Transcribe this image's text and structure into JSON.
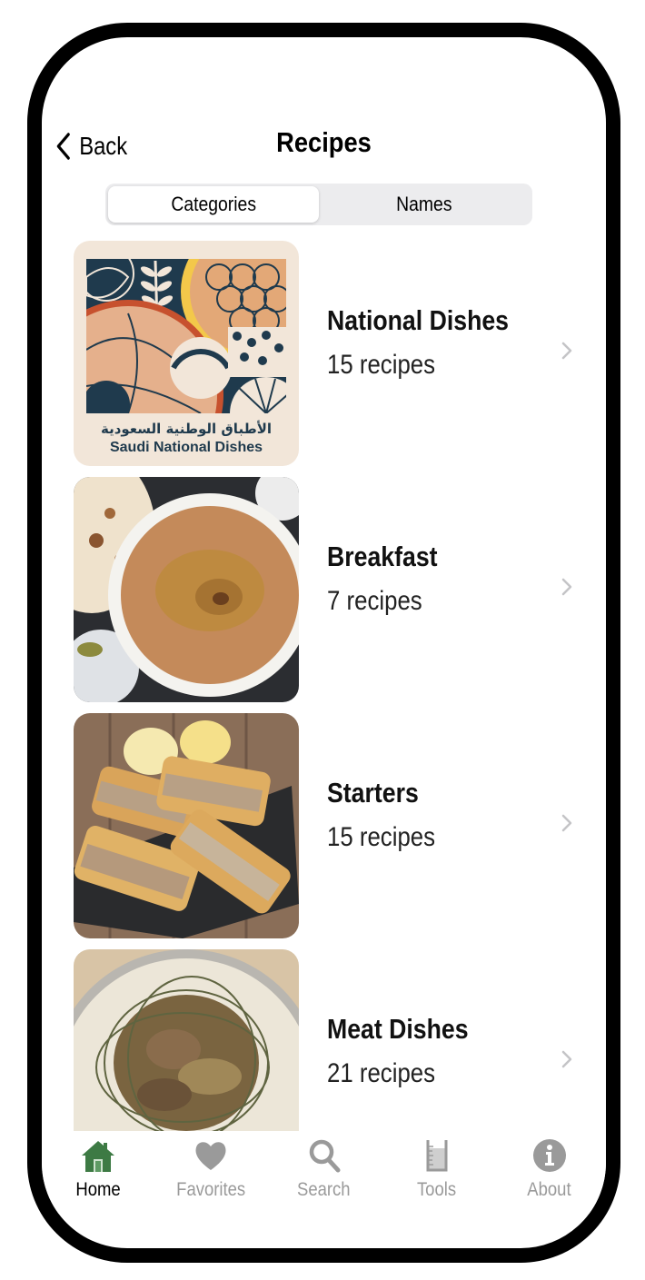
{
  "header": {
    "back_label": "Back",
    "title": "Recipes"
  },
  "segmented": {
    "options": [
      "Categories",
      "Names"
    ],
    "selected": "Categories"
  },
  "categories": [
    {
      "name": "National Dishes",
      "count": "15 recipes",
      "image": "Saudi National Dishes logo",
      "logo_text_ar": "الأطباق الوطنية السعودية",
      "logo_text_en": "Saudi National Dishes"
    },
    {
      "name": "Breakfast",
      "count": "7 recipes",
      "image": "bowl of ful medames with bread"
    },
    {
      "name": "Starters",
      "count": "15 recipes",
      "image": "mutabbaq pastries with lemon"
    },
    {
      "name": "Meat Dishes",
      "count": "21 recipes",
      "image": "meat on rice platter"
    }
  ],
  "tabbar": {
    "items": [
      {
        "label": "Home",
        "icon": "house-icon",
        "active": true
      },
      {
        "label": "Favorites",
        "icon": "heart-icon",
        "active": false
      },
      {
        "label": "Search",
        "icon": "search-icon",
        "active": false
      },
      {
        "label": "Tools",
        "icon": "beaker-icon",
        "active": false
      },
      {
        "label": "About",
        "icon": "info-icon",
        "active": false
      }
    ]
  },
  "colors": {
    "active_tab_icon": "#3d7a44",
    "inactive_tab": "#9a9a9a",
    "chevron": "#c4c4c7",
    "segment_bg": "#ececee"
  }
}
